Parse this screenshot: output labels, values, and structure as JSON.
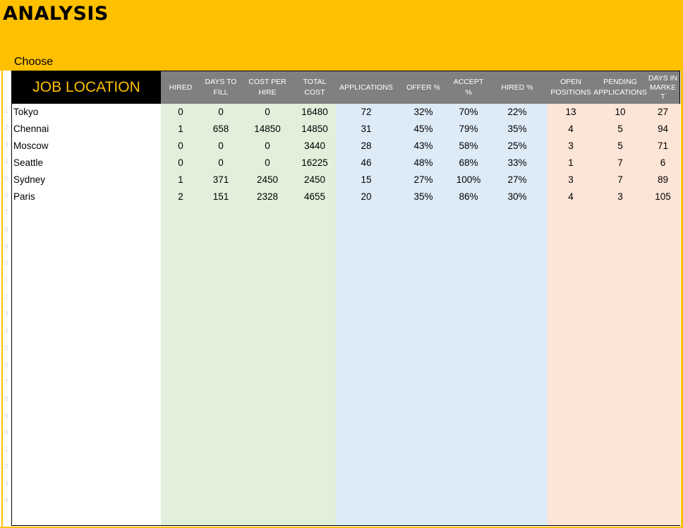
{
  "title": "ANALYSIS",
  "choose_label": "Choose",
  "job_location_header": "JOB LOCATION",
  "columns": [
    {
      "label": "HIRED"
    },
    {
      "label": "DAYS TO\nFILL"
    },
    {
      "label": "COST PER\nHIRE"
    },
    {
      "label": "TOTAL\nCOST"
    },
    {
      "label": "APPLICATIONS"
    },
    {
      "label": "OFFER %"
    },
    {
      "label": "ACCEPT %"
    },
    {
      "label": "HIRED %"
    },
    {
      "label": "OPEN\nPOSITIONS"
    },
    {
      "label": "PENDING\nAPPLICATIONS"
    },
    {
      "label": "DAYS IN\nMARKE\nT"
    }
  ],
  "rows": [
    {
      "location": "Tokyo",
      "hired": "0",
      "days_to_fill": "0",
      "cost_per_hire": "0",
      "total_cost": "16480",
      "applications": "72",
      "offer_pct": "32%",
      "accept_pct": "70%",
      "hired_pct": "22%",
      "open_positions": "13",
      "pending_applications": "10",
      "days_in_market": "27"
    },
    {
      "location": "Chennai",
      "hired": "1",
      "days_to_fill": "658",
      "cost_per_hire": "14850",
      "total_cost": "14850",
      "applications": "31",
      "offer_pct": "45%",
      "accept_pct": "79%",
      "hired_pct": "35%",
      "open_positions": "4",
      "pending_applications": "5",
      "days_in_market": "94"
    },
    {
      "location": "Moscow",
      "hired": "0",
      "days_to_fill": "0",
      "cost_per_hire": "0",
      "total_cost": "3440",
      "applications": "28",
      "offer_pct": "43%",
      "accept_pct": "58%",
      "hired_pct": "25%",
      "open_positions": "3",
      "pending_applications": "5",
      "days_in_market": "71"
    },
    {
      "location": "Seattle",
      "hired": "0",
      "days_to_fill": "0",
      "cost_per_hire": "0",
      "total_cost": "16225",
      "applications": "46",
      "offer_pct": "48%",
      "accept_pct": "68%",
      "hired_pct": "33%",
      "open_positions": "1",
      "pending_applications": "7",
      "days_in_market": "6"
    },
    {
      "location": "Sydney",
      "hired": "1",
      "days_to_fill": "371",
      "cost_per_hire": "2450",
      "total_cost": "2450",
      "applications": "15",
      "offer_pct": "27%",
      "accept_pct": "100%",
      "hired_pct": "27%",
      "open_positions": "3",
      "pending_applications": "7",
      "days_in_market": "89"
    },
    {
      "location": "Paris",
      "hired": "2",
      "days_to_fill": "151",
      "cost_per_hire": "2328",
      "total_cost": "4655",
      "applications": "20",
      "offer_pct": "35%",
      "accept_pct": "86%",
      "hired_pct": "30%",
      "open_positions": "4",
      "pending_applications": "3",
      "days_in_market": "105"
    }
  ],
  "row_numbers": [
    "1",
    "2",
    "3",
    "4",
    "5",
    "6",
    "7",
    "8",
    "9",
    "0",
    "1",
    "2",
    "3",
    "4",
    "5",
    "6",
    "7",
    "8",
    "9",
    "0",
    "1",
    "2",
    "3",
    "4"
  ],
  "colors": {
    "accent": "#ffc000",
    "header_gray": "#808080",
    "cost_band": "#e2efda",
    "funnel_band": "#ddebf7",
    "pipeline_band": "#fce4d6"
  }
}
